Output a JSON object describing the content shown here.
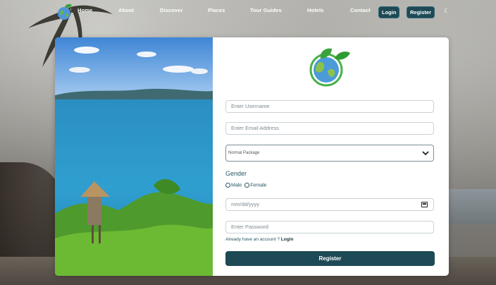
{
  "nav": {
    "items": [
      "Home",
      "About",
      "Discover",
      "Places",
      "Tour Guides",
      "Hotels",
      "Contact"
    ],
    "login_label": "Login",
    "register_label": "Register",
    "theme_icon": "moon-icon"
  },
  "form": {
    "username_placeholder": "Enter Username",
    "email_placeholder": "Enter Email Address",
    "package_selected": "Normal Package",
    "gender_label": "Gender",
    "gender_options": [
      "Male",
      "Female"
    ],
    "date_placeholder": "mm/dd/yyyy",
    "password_placeholder": "Enter Password",
    "already_text": "Already have an account ?",
    "login_link": "Login",
    "register_button": "Register"
  },
  "colors": {
    "primary": "#1d4a55",
    "accent_text": "#2a5866"
  }
}
